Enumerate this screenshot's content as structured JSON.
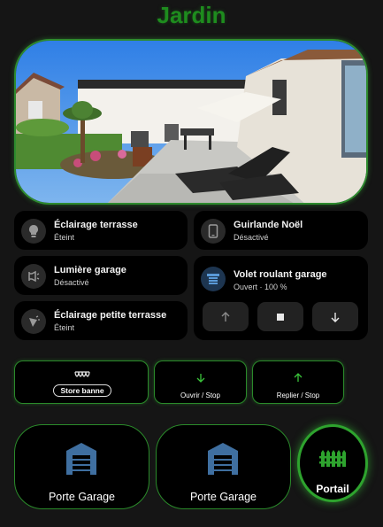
{
  "page_title": "Jardin",
  "tiles": {
    "eclairage_terrasse": {
      "name": "Éclairage terrasse",
      "state": "Éteint",
      "icon": "lightbulb-icon"
    },
    "guirlande": {
      "name": "Guirlande Noël",
      "state": "Désactivé",
      "icon": "smartphone-icon"
    },
    "lumiere_garage": {
      "name": "Lumière garage",
      "state": "Désactivé",
      "icon": "wall-light-icon"
    },
    "volet": {
      "name": "Volet roulant garage",
      "state": "Ouvert · 100 %",
      "icon": "roller-shutter-icon",
      "position_percent": 100
    },
    "eclairage_petite": {
      "name": "Éclairage petite terrasse",
      "state": "Éteint",
      "icon": "light-off-icon"
    }
  },
  "store": {
    "label": "Store banne",
    "open_label": "Ouvrir / Stop",
    "close_label": "Replier / Stop"
  },
  "garages": [
    {
      "label": "Porte Garage",
      "icon": "garage-door-icon"
    },
    {
      "label": "Porte Garage",
      "icon": "garage-door-icon"
    }
  ],
  "portail": {
    "label": "Portail",
    "icon": "gate-icon"
  },
  "colors": {
    "accent_green": "#2e8b2e",
    "title_green": "#1e8c1e",
    "cover_blue": "#5a9ad8",
    "garage_blue": "#3f6fa0"
  }
}
